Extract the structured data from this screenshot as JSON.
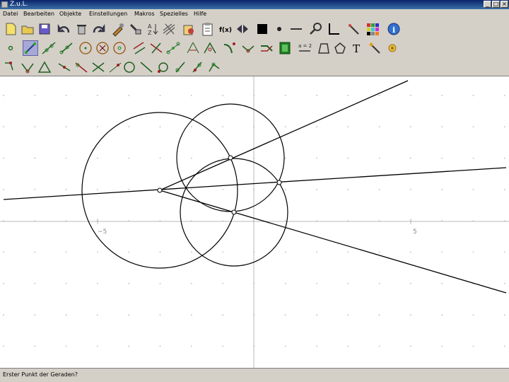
{
  "window": {
    "title": "Z.u.L.",
    "buttons": [
      "_",
      "□",
      "×"
    ]
  },
  "menu": [
    "Datei",
    "Bearbeiten",
    "Objekte",
    "Einstellungen",
    "Makros",
    "Spezielles",
    "Hilfe"
  ],
  "toolbar": {
    "row1": [
      "new-file-icon",
      "open-file-icon",
      "save-file-icon",
      "undo-icon",
      "delete-icon",
      "redo-icon",
      "edit-object-icon",
      "hide-icon",
      "sort-icon",
      "grid-icon",
      "replay-icon",
      "macro-icon",
      "function-icon",
      "show-hide-icon",
      "color-black-icon",
      "point-size-icon",
      "line-style-icon",
      "zoom-icon",
      "axes-icon",
      "color-wand-icon",
      "color-palette-icon",
      "info-icon"
    ],
    "row2": [
      "point-icon",
      "segment-tool-icon",
      "line-icon",
      "ray-icon",
      "circle-icon",
      "circle-through-point-icon",
      "circle3-icon",
      "parallel-icon",
      "perpendicular-icon",
      "midpoint-icon",
      "intersection-icon",
      "triangle-tool-icon",
      "angle-icon",
      "angle-mark-icon",
      "reflect-icon",
      "move-icon",
      "animation-icon",
      "fixed-point-icon",
      "polygon-icon",
      "arc-icon",
      "text-icon",
      "tracker-icon",
      "animate-icon"
    ],
    "row3": [
      "point-on-object-icon",
      "bound-point-icon",
      "triangle-icon",
      "line-segment-icon",
      "fixed-segment-icon",
      "fixed-angle-icon",
      "three-point-circle-icon",
      "hide-line-icon",
      "chain-icon",
      "vector-icon",
      "moving-point-icon",
      "dual-point-icon",
      "object-tracker-icon"
    ],
    "selected": "segment-tool-icon"
  },
  "canvas": {
    "axis_labels": {
      "x_neg": "−5",
      "x_pos": "5"
    }
  },
  "status": "Erster Punkt der Geraden?"
}
